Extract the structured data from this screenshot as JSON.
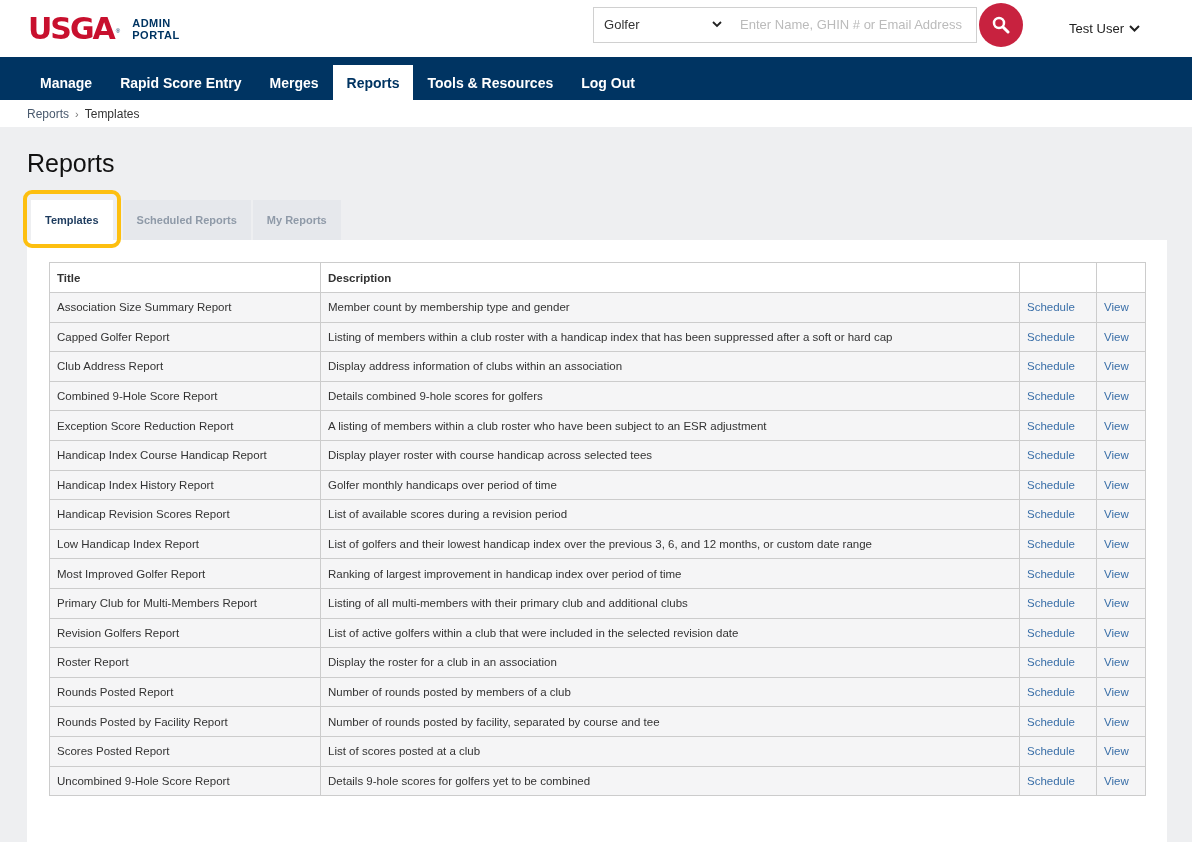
{
  "logo": {
    "wordmark": "USGA",
    "registered": "®",
    "subtitle_lines": [
      "ADMIN",
      "PORTAL"
    ]
  },
  "search": {
    "type_select": "Golfer",
    "placeholder": "Enter Name, GHIN # or Email Address"
  },
  "user_menu": {
    "label": "Test User"
  },
  "nav": [
    {
      "label": "Manage",
      "selected": false
    },
    {
      "label": "Rapid Score Entry",
      "selected": false
    },
    {
      "label": "Merges",
      "selected": false
    },
    {
      "label": "Reports",
      "selected": true
    },
    {
      "label": "Tools & Resources",
      "selected": false
    },
    {
      "label": "Log Out",
      "selected": false
    }
  ],
  "breadcrumb": [
    "Reports",
    "Templates"
  ],
  "breadcrumb_separator": "›",
  "page_title": "Reports",
  "tabs": [
    {
      "label": "Templates",
      "selected": true,
      "highlighted": true
    },
    {
      "label": "Scheduled Reports",
      "selected": false,
      "highlighted": false
    },
    {
      "label": "My Reports",
      "selected": false,
      "highlighted": false
    }
  ],
  "table": {
    "columns": [
      "Title",
      "Description"
    ],
    "rows": [
      {
        "title": "Association Size Summary Report",
        "description": "Member count by membership type and gender",
        "actions": [
          "Schedule",
          "View"
        ]
      },
      {
        "title": "Capped Golfer Report",
        "description": "Listing of members within a club roster with a handicap index that has been suppressed after a soft or hard cap",
        "actions": [
          "Schedule",
          "View"
        ]
      },
      {
        "title": "Club Address Report",
        "description": "Display address information of clubs within an association",
        "actions": [
          "Schedule",
          "View"
        ]
      },
      {
        "title": "Combined 9-Hole Score Report",
        "description": "Details combined 9-hole scores for golfers",
        "actions": [
          "Schedule",
          "View"
        ]
      },
      {
        "title": "Exception Score Reduction Report",
        "description": "A listing of members within a club roster who have been subject to an ESR adjustment",
        "actions": [
          "Schedule",
          "View"
        ]
      },
      {
        "title": "Handicap Index Course Handicap Report",
        "description": "Display player roster with course handicap across selected tees",
        "actions": [
          "Schedule",
          "View"
        ]
      },
      {
        "title": "Handicap Index History Report",
        "description": "Golfer monthly handicaps over period of time",
        "actions": [
          "Schedule",
          "View"
        ]
      },
      {
        "title": "Handicap Revision Scores Report",
        "description": "List of available scores during a revision period",
        "actions": [
          "Schedule",
          "View"
        ]
      },
      {
        "title": "Low Handicap Index Report",
        "description": "List of golfers and their lowest handicap index over the previous 3, 6, and 12 months, or custom date range",
        "actions": [
          "Schedule",
          "View"
        ]
      },
      {
        "title": "Most Improved Golfer Report",
        "description": "Ranking of largest improvement in handicap index over period of time",
        "actions": [
          "Schedule",
          "View"
        ]
      },
      {
        "title": "Primary Club for Multi-Members Report",
        "description": "Listing of all multi-members with their primary club and additional clubs",
        "actions": [
          "Schedule",
          "View"
        ]
      },
      {
        "title": "Revision Golfers Report",
        "description": "List of active golfers within a club that were included in the selected revision date",
        "actions": [
          "Schedule",
          "View"
        ]
      },
      {
        "title": "Roster Report",
        "description": "Display the roster for a club in an association",
        "actions": [
          "Schedule",
          "View"
        ]
      },
      {
        "title": "Rounds Posted Report",
        "description": "Number of rounds posted by members of a club",
        "actions": [
          "Schedule",
          "View"
        ]
      },
      {
        "title": "Rounds Posted by Facility Report",
        "description": "Number of rounds posted by facility, separated by course and tee",
        "actions": [
          "Schedule",
          "View"
        ]
      },
      {
        "title": "Scores Posted Report",
        "description": "List of scores posted at a club",
        "actions": [
          "Schedule",
          "View"
        ]
      },
      {
        "title": "Uncombined 9-Hole Score Report",
        "description": "Details 9-hole scores for golfers yet to be combined",
        "actions": [
          "Schedule",
          "View"
        ]
      }
    ]
  }
}
